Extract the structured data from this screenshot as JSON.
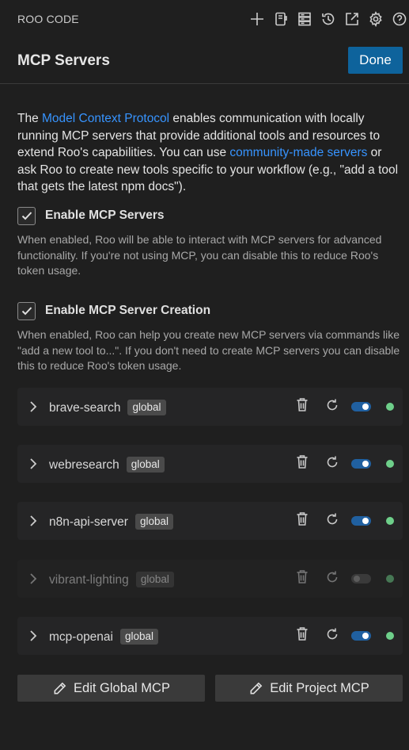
{
  "app": {
    "title": "ROO CODE"
  },
  "toolbar": {
    "icons": [
      "plus-icon",
      "prompts-icon",
      "mcp-servers-icon",
      "history-icon",
      "popout-icon",
      "settings-icon",
      "help-icon"
    ]
  },
  "header": {
    "title": "MCP Servers",
    "done_label": "Done"
  },
  "intro": {
    "part1": "The ",
    "link1": "Model Context Protocol",
    "part2": " enables communication with locally running MCP servers that provide additional tools and resources to extend Roo's capabilities. You can use ",
    "link2": "community-made servers",
    "part3": " or ask Roo to create new tools specific to your workflow (e.g., \"add a tool that gets the latest npm docs\")."
  },
  "options": [
    {
      "label": "Enable MCP Servers",
      "checked": true,
      "description": "When enabled, Roo will be able to interact with MCP servers for advanced functionality. If you're not using MCP, you can disable this to reduce Roo's token usage."
    },
    {
      "label": "Enable MCP Server Creation",
      "checked": true,
      "description": "When enabled, Roo can help you create new MCP servers via commands like \"add a new tool to...\". If you don't need to create MCP servers you can disable this to reduce Roo's token usage."
    }
  ],
  "servers": [
    {
      "name": "brave-search",
      "scope": "global",
      "enabled": true
    },
    {
      "name": "webresearch",
      "scope": "global",
      "enabled": true
    },
    {
      "name": "n8n-api-server",
      "scope": "global",
      "enabled": true
    },
    {
      "name": "vibrant-lighting",
      "scope": "global",
      "enabled": false
    },
    {
      "name": "mcp-openai",
      "scope": "global",
      "enabled": true
    }
  ],
  "footer": {
    "edit_global_label": "Edit Global MCP",
    "edit_project_label": "Edit Project MCP"
  },
  "colors": {
    "accent": "#0e639c",
    "link": "#3794ff",
    "status_ok": "#6ecf8a",
    "background": "#1f1f1f"
  }
}
